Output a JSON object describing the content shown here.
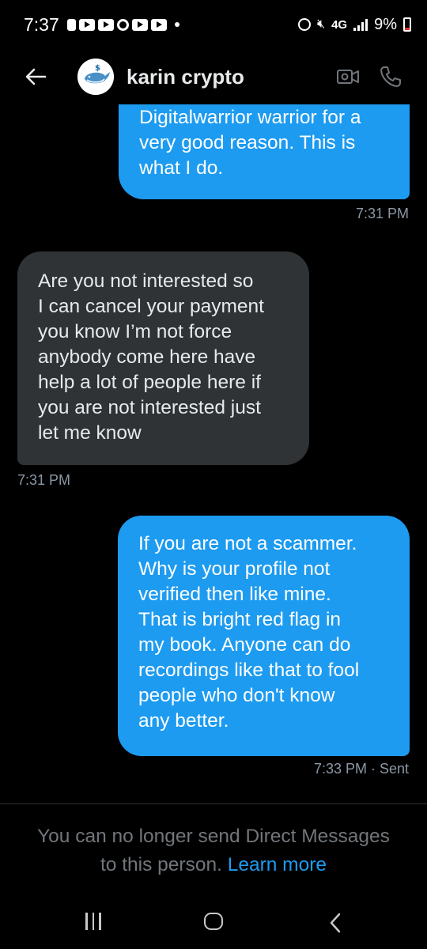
{
  "status_bar": {
    "time": "7:37",
    "network": "4G",
    "battery": "9%",
    "icons": [
      "notification-icon",
      "youtube-icon",
      "youtube-icon",
      "circle-icon",
      "youtube-icon",
      "youtube-icon",
      "alarm-icon",
      "mute-icon",
      "signal-icon",
      "battery-icon"
    ]
  },
  "header": {
    "contact_name": "karin crypto",
    "avatar": "whale-dollar-avatar",
    "back_icon": "back-arrow-icon",
    "video_icon": "video-call-icon",
    "phone_icon": "phone-call-icon"
  },
  "messages": [
    {
      "direction": "sent",
      "lines": [
        "Digitalwarrior warrior for a",
        "very good reason.  This is",
        "what I do."
      ],
      "timestamp": "7:31 PM"
    },
    {
      "direction": "received",
      "lines": [
        "Are you not interested so",
        "I can cancel your payment",
        "you know I’m not force",
        "anybody come here have",
        "help a lot of people here if",
        "you are not interested just",
        "let me know"
      ],
      "timestamp": "7:31 PM"
    },
    {
      "direction": "sent",
      "lines": [
        "If you are not a scammer.",
        "Why is your profile not",
        "verified then like mine.",
        "That is bright red flag in",
        "my book. Anyone can do",
        "recordings like that to fool",
        "people who don't know",
        "any better."
      ],
      "timestamp": "7:33 PM · Sent"
    }
  ],
  "footer": {
    "notice_line1": "You can no longer send Direct Messages",
    "notice_line2_prefix": "to this person. ",
    "notice_link": "Learn more"
  },
  "colors": {
    "background": "#000000",
    "sent_bubble": "#1d9bf0",
    "received_bubble": "#2f3336",
    "link": "#1d9bf0",
    "muted_text": "#71767b"
  }
}
